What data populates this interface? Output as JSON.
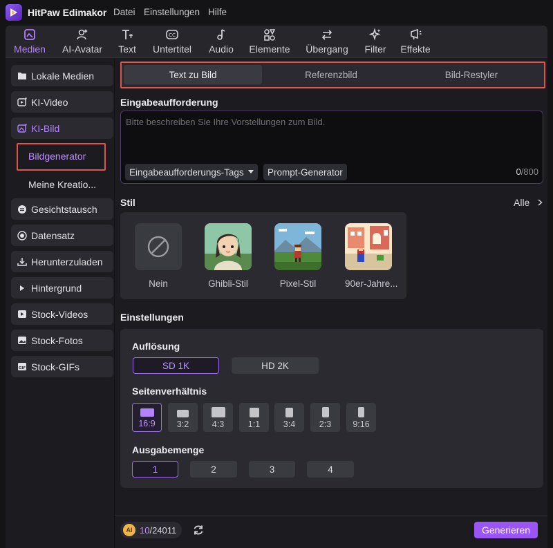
{
  "app": {
    "title": "HitPaw Edimakor",
    "menu": [
      "Datei",
      "Einstellungen",
      "Hilfe"
    ]
  },
  "toolbar": {
    "items": [
      {
        "label": "Medien",
        "icon": "media-icon",
        "active": true
      },
      {
        "label": "AI-Avatar",
        "icon": "avatar-icon"
      },
      {
        "label": "Text",
        "icon": "text-icon"
      },
      {
        "label": "Untertitel",
        "icon": "subtitle-icon"
      },
      {
        "label": "Audio",
        "icon": "audio-icon"
      },
      {
        "label": "Elemente",
        "icon": "elements-icon"
      },
      {
        "label": "Übergang",
        "icon": "transition-icon"
      },
      {
        "label": "Filter",
        "icon": "filter-icon"
      },
      {
        "label": "Effekte",
        "icon": "effects-icon"
      }
    ]
  },
  "sidebar": {
    "items": [
      {
        "label": "Lokale Medien",
        "icon": "folder-icon"
      },
      {
        "label": "KI-Video",
        "icon": "ai-video-icon"
      },
      {
        "label": "KI-Bild",
        "icon": "ai-image-icon",
        "active": true
      },
      {
        "label": "Gesichtstausch",
        "icon": "face-swap-icon"
      },
      {
        "label": "Datensatz",
        "icon": "dataset-icon"
      },
      {
        "label": "Herunterzuladen",
        "icon": "download-icon"
      },
      {
        "label": "Hintergrund",
        "icon": "caret-right-icon"
      },
      {
        "label": "Stock-Videos",
        "icon": "stock-video-icon"
      },
      {
        "label": "Stock-Fotos",
        "icon": "stock-photo-icon"
      },
      {
        "label": "Stock-GIFs",
        "icon": "gif-icon"
      }
    ],
    "sub_items": [
      {
        "label": "Bildgenerator",
        "active": true
      },
      {
        "label": "Meine Kreatio..."
      }
    ]
  },
  "tabs": [
    {
      "label": "Text zu Bild",
      "active": true
    },
    {
      "label": "Referenzbild"
    },
    {
      "label": "Bild-Restyler"
    }
  ],
  "prompt": {
    "title": "Eingabeaufforderung",
    "placeholder": "Bitte beschreiben Sie Ihre Vorstellungen zum Bild.",
    "tags_label": "Eingabeaufforderungs-Tags",
    "generator_label": "Prompt-Generator",
    "count": "0",
    "max": "/800"
  },
  "style": {
    "title": "Stil",
    "all_label": "Alle",
    "options": [
      {
        "label": "Nein"
      },
      {
        "label": "Ghibli-Stil"
      },
      {
        "label": "Pixel-Stil"
      },
      {
        "label": "90er-Jahre..."
      }
    ]
  },
  "settings": {
    "title": "Einstellungen",
    "resolution": {
      "title": "Auflösung",
      "options": [
        "SD 1K",
        "HD 2K"
      ],
      "selected": "SD 1K"
    },
    "aspect": {
      "title": "Seitenverhältnis",
      "options": [
        "16:9",
        "3:2",
        "4:3",
        "1:1",
        "3:4",
        "2:3",
        "9:16"
      ],
      "selected": "16:9"
    },
    "quantity": {
      "title": "Ausgabemenge",
      "options": [
        "1",
        "2",
        "3",
        "4"
      ],
      "selected": "1"
    }
  },
  "footer": {
    "coin_label": "AI",
    "credits_current": "10",
    "credits_total": "/24011",
    "generate_label": "Generieren"
  },
  "colors": {
    "accent": "#9b55f5",
    "highlight": "#e2544b"
  }
}
